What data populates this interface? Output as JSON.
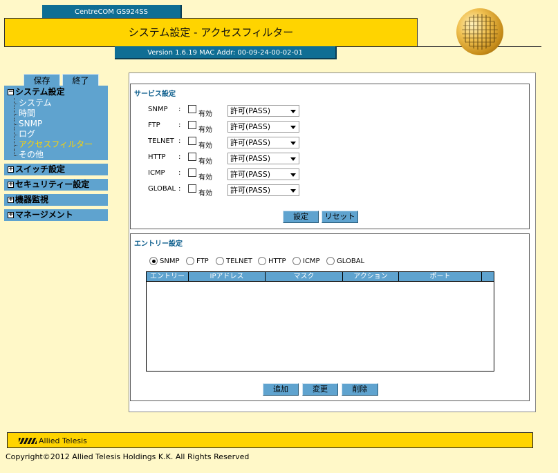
{
  "header": {
    "model": "CentreCOM GS924SS",
    "title": "システム設定 - アクセスフィルター",
    "version": "Version 1.6.19 MAC Addr: 00-09-24-00-02-01"
  },
  "sidebar": {
    "save_label": "保存",
    "exit_label": "終了",
    "system_section": {
      "label": "システム設定",
      "items": [
        {
          "label": "システム"
        },
        {
          "label": "時間"
        },
        {
          "label": "SNMP"
        },
        {
          "label": "ログ"
        },
        {
          "label": "アクセスフィルター",
          "active": true
        },
        {
          "label": "その他"
        }
      ]
    },
    "categories": [
      {
        "label": "スイッチ設定"
      },
      {
        "label": "セキュリティー設定"
      },
      {
        "label": "機器監視"
      },
      {
        "label": "マネージメント"
      }
    ]
  },
  "service_settings": {
    "title": "サービス設定",
    "enable_label": "有効",
    "rows": [
      {
        "service": "SNMP",
        "enabled": false,
        "action": "許可(PASS)"
      },
      {
        "service": "FTP",
        "enabled": false,
        "action": "許可(PASS)"
      },
      {
        "service": "TELNET",
        "enabled": false,
        "action": "許可(PASS)"
      },
      {
        "service": "HTTP",
        "enabled": false,
        "action": "許可(PASS)"
      },
      {
        "service": "ICMP",
        "enabled": false,
        "action": "許可(PASS)"
      },
      {
        "service": "GLOBAL",
        "enabled": false,
        "action": "許可(PASS)"
      }
    ],
    "apply_label": "設定",
    "reset_label": "リセット"
  },
  "entry_settings": {
    "title": "エントリー設定",
    "radios": [
      {
        "label": "SNMP",
        "selected": true
      },
      {
        "label": "FTP",
        "selected": false
      },
      {
        "label": "TELNET",
        "selected": false
      },
      {
        "label": "HTTP",
        "selected": false
      },
      {
        "label": "ICMP",
        "selected": false
      },
      {
        "label": "GLOBAL",
        "selected": false
      }
    ],
    "columns": [
      "エントリー",
      "IPアドレス",
      "マスク",
      "アクション",
      "ポート"
    ],
    "rows": [],
    "add_label": "追加",
    "change_label": "変更",
    "delete_label": "削除"
  },
  "footer": {
    "brand": "Allied Telesis",
    "copyright": "Copyright©2012 Allied Telesis Holdings K.K. All Rights Reserved"
  },
  "colors": {
    "background": "#fff8c8",
    "accent_yellow": "#ffd400",
    "teal": "#0f6e94",
    "sidebar_blue": "#5fa3cf",
    "active_item": "#ffd400",
    "section_title": "#0b5d8c"
  }
}
